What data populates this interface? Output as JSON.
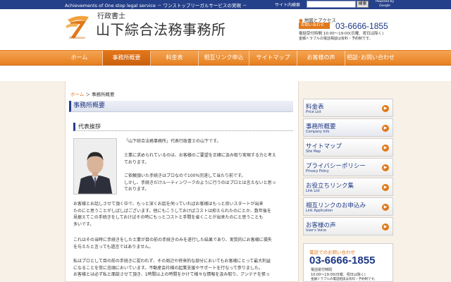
{
  "topbar": {
    "tagline": "Achievements of One stop legal service － ワンストップリーガルサービスの実現 －",
    "search_label": "サイト内検索",
    "search_value": "",
    "search_button": "検索",
    "powered_by": "Powered by",
    "powered_brand": "Google"
  },
  "header": {
    "logo_caption": "U.Solution",
    "title_small": "行政書士",
    "title_main": "山下綜合法務事務所",
    "access_link": "地図とアクセス",
    "contact_badge": "お問い合わせ",
    "phone": "03-6666-1855",
    "hours": "電話受付時間 10:00～19:00(日曜、祝日は除く)",
    "hours_note": "金銭トラブルの電話相談は有料・予約制です。"
  },
  "nav": [
    {
      "label": "ホーム"
    },
    {
      "label": "事務所概要"
    },
    {
      "label": "料金表"
    },
    {
      "label": "相互リンク申込"
    },
    {
      "label": "サイトマップ"
    },
    {
      "label": "お客様の声"
    },
    {
      "label": "相談･お問い合わせ"
    }
  ],
  "breadcrumb": {
    "home": "ホーム",
    "separator": "＞",
    "current": "事務所概要"
  },
  "main": {
    "page_heading": "事務所概要",
    "section_title": "代表挨拶",
    "greeting": "「山下綜合法務事務所」代表行政書士の山下です。",
    "p1_l1": "士業に求められているのは、お客様のご要望を正確に汲み取り実現する力と考え",
    "p1_l2": "ております。",
    "p2_l1": "ご依頼頂いた手続きはプロなので100%完遂して当たり前です。",
    "p2_l2": "しかし、手続きだけルーティンワークのように行うのはプロとは言えないと思っ",
    "p2_l3": "ております。",
    "p3_l1": "お客様とお話しさせて頂く中で、もっと深くお話を伺っていればお客様はもっと良いスタートが出来",
    "p3_l2": "たのにと思うことがしばしばございます。他にもこうしておけばコストは抑えられたのにとか、数年後を",
    "p3_l3": "見据えてこの手続きをしておけばその時にもっとコストと手間を省くことが出来たのにと思うことも",
    "p3_l4": "多いです。",
    "p4_l1": "これはその当時に手続きをした士業が目の前の手続きのみを遂行した結果であり、実質的にお客様に損失",
    "p4_l2": "を与えたと言っても過言ではありません。",
    "p5_l1": "私はプロとして目の前の手続きに捉われず、その周辺や将来的な部分においてもお客様にとって最大利益",
    "p5_l2": "になることを常に念頭においています。不動産会社様の起業支援やサポートを行なって参りました。",
    "p5_l3": "お客様とは必ず私と面談させて頂き、1時間以上の時間をかけて様々な情報を汲み取り、アンテナを張っ"
  },
  "sidebar": [
    {
      "jp": "料金表",
      "en": "Price List"
    },
    {
      "jp": "事務所概要",
      "en": "Company Info"
    },
    {
      "jp": "サイトマップ",
      "en": "Site Map"
    },
    {
      "jp": "プライバシーポリシー",
      "en": "Privacy Policy"
    },
    {
      "jp": "お役立ちリンク集",
      "en": "Link List"
    },
    {
      "jp": "相互リンクのお申込み",
      "en": "Link Application"
    },
    {
      "jp": "お客様の声",
      "en": "User's Voice"
    }
  ],
  "side_contact": {
    "label": "電話でのお問い合わせ",
    "phone": "03-6666-1855",
    "hours_label": "電話受付時間",
    "hours": "10:00～19:00(日曜、祝日は除く)",
    "note": "金銭トラブルの電話相談は有料・予約制です。"
  },
  "colors": {
    "brand_blue": "#25408a",
    "accent_orange": "#e0781b"
  }
}
